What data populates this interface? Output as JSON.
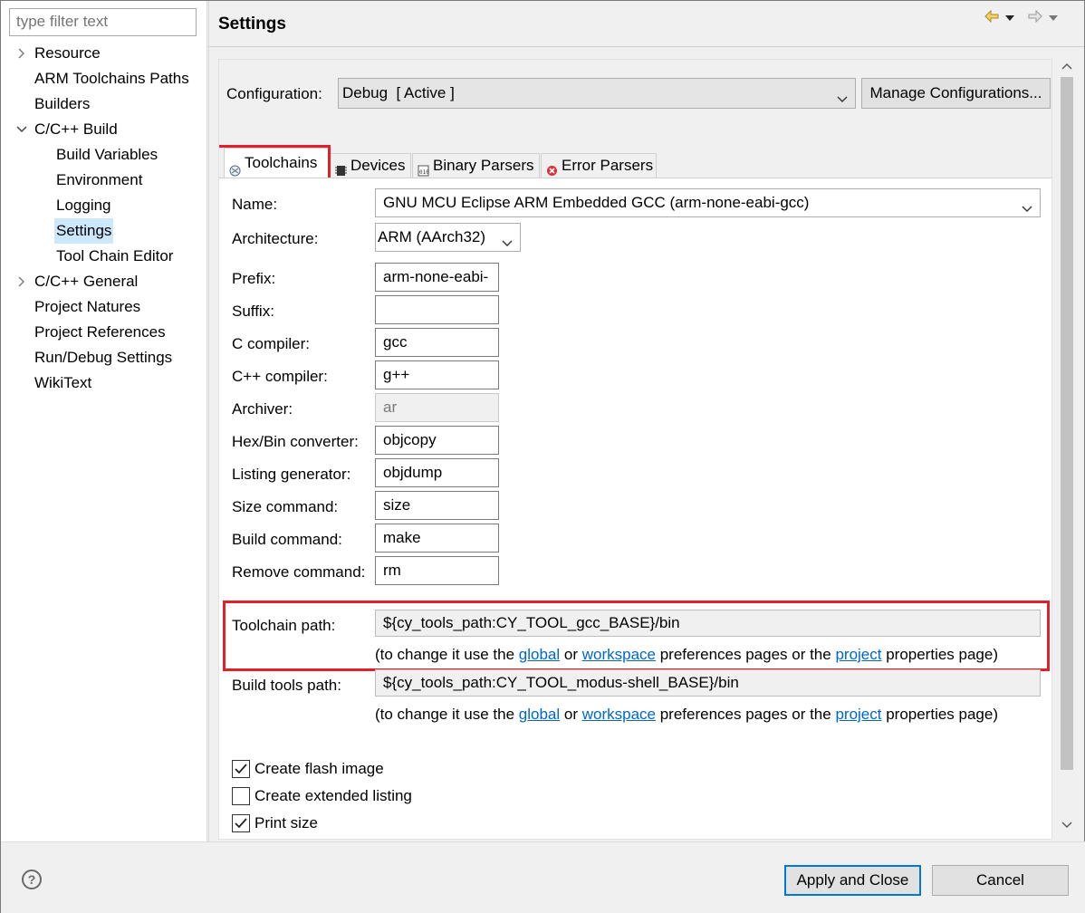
{
  "filter": {
    "placeholder": "type filter text"
  },
  "tree": [
    {
      "label": "Resource",
      "level": 1,
      "twisty": "collapsed"
    },
    {
      "label": "ARM Toolchains Paths",
      "level": 1
    },
    {
      "label": "Builders",
      "level": 1
    },
    {
      "label": "C/C++ Build",
      "level": 1,
      "twisty": "expanded"
    },
    {
      "label": "Build Variables",
      "level": 2
    },
    {
      "label": "Environment",
      "level": 2
    },
    {
      "label": "Logging",
      "level": 2
    },
    {
      "label": "Settings",
      "level": 2,
      "selected": true
    },
    {
      "label": "Tool Chain Editor",
      "level": 2
    },
    {
      "label": "C/C++ General",
      "level": 1,
      "twisty": "collapsed"
    },
    {
      "label": "Project Natures",
      "level": 1
    },
    {
      "label": "Project References",
      "level": 1
    },
    {
      "label": "Run/Debug Settings",
      "level": 1
    },
    {
      "label": "WikiText",
      "level": 1
    }
  ],
  "header": {
    "title": "Settings",
    "icons": [
      "back-arrow-icon",
      "dropdown-icon",
      "forward-arrow-icon",
      "dropdown-icon"
    ]
  },
  "configuration": {
    "label": "Configuration:",
    "value": "Debug  [ Active ]",
    "manage_label": "Manage Configurations..."
  },
  "tabs": [
    {
      "label": "Toolchains",
      "icon": "toolchains-icon",
      "active": true
    },
    {
      "label": "Devices",
      "icon": "chip-icon"
    },
    {
      "label": "Binary Parsers",
      "icon": "binary-icon"
    },
    {
      "label": "Error Parsers",
      "icon": "error-icon"
    }
  ],
  "toolchain": {
    "name_label": "Name:",
    "name_value": "GNU MCU Eclipse ARM Embedded GCC (arm-none-eabi-gcc)",
    "arch_label": "Architecture:",
    "arch_value": "ARM (AArch32)",
    "fields": [
      {
        "label": "Prefix:",
        "value": "arm-none-eabi-"
      },
      {
        "label": "Suffix:",
        "value": ""
      },
      {
        "label": "C compiler:",
        "value": "gcc"
      },
      {
        "label": "C++ compiler:",
        "value": "g++"
      },
      {
        "label": "Archiver:",
        "value": "ar",
        "readonly": true
      },
      {
        "label": "Hex/Bin converter:",
        "value": "objcopy"
      },
      {
        "label": "Listing generator:",
        "value": "objdump"
      },
      {
        "label": "Size command:",
        "value": "size"
      },
      {
        "label": "Build command:",
        "value": "make"
      },
      {
        "label": "Remove command:",
        "value": "rm"
      }
    ],
    "toolchain_path_label": "Toolchain path:",
    "toolchain_path_value": "${cy_tools_path:CY_TOOL_gcc_BASE}/bin",
    "build_tools_path_label": "Build tools path:",
    "build_tools_path_value": "${cy_tools_path:CY_TOOL_modus-shell_BASE}/bin",
    "hint": {
      "prefix": "(to change it use the ",
      "global": "global",
      "or": " or ",
      "workspace": "workspace",
      "middle": " preferences pages or the ",
      "project": "project",
      "suffix": " properties page)"
    }
  },
  "checkboxes": [
    {
      "label": "Create flash image",
      "checked": true
    },
    {
      "label": "Create extended listing",
      "checked": false
    },
    {
      "label": "Print size",
      "checked": true
    }
  ],
  "footer": {
    "apply_label": "Apply and Close",
    "cancel_label": "Cancel",
    "help_glyph": "?"
  },
  "colors": {
    "highlight_box": "#e0202a",
    "link": "#0066cc",
    "selection": "#cce8ff",
    "default_button_border": "#0078d7"
  }
}
